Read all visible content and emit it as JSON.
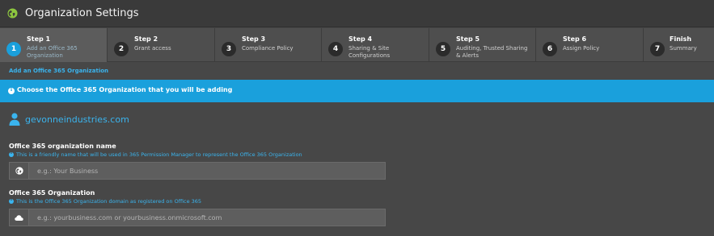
{
  "header": {
    "title": "Organization Settings",
    "logo_icon": "globe-icon"
  },
  "steps": [
    {
      "num": "1",
      "label": "Step 1",
      "desc": "Add an Office 365 Organization",
      "active": true
    },
    {
      "num": "2",
      "label": "Step 2",
      "desc": "Grant access",
      "active": false
    },
    {
      "num": "3",
      "label": "Step 3",
      "desc": "Compliance Policy",
      "active": false
    },
    {
      "num": "4",
      "label": "Step 4",
      "desc": "Sharing & Site Configurations",
      "active": false
    },
    {
      "num": "5",
      "label": "Step 5",
      "desc": "Auditing, Trusted Sharing & Alerts",
      "active": false
    },
    {
      "num": "6",
      "label": "Step 6",
      "desc": "Assign Policy",
      "active": false
    },
    {
      "num": "7",
      "label": "Finish",
      "desc": "Summary",
      "active": false
    }
  ],
  "breadcrumb": "Add an Office 365 Organization",
  "banner": {
    "text": "Choose the Office 365 Organization that you will be adding",
    "icon": "info-icon"
  },
  "organization": {
    "name": "gevonneindustries.com",
    "icon": "user-icon"
  },
  "form": {
    "name_field": {
      "label": "Office 365 organization name",
      "hint": "This is a friendly name that will be used in 365 Permission Manager to represent the Office 365 Organization",
      "placeholder": "e.g.: Your Business",
      "value": "",
      "icon": "globe-icon"
    },
    "domain_field": {
      "label": "Office 365 Organization",
      "hint": "This is the Office 365 Organization domain as registered on Office 365",
      "placeholder": "e.g.: yourbusiness.com or yourbusiness.onmicrosoft.com",
      "value": "",
      "icon": "cloud-icon"
    }
  },
  "colors": {
    "accent": "#1aa0dc",
    "link": "#3ab4ee",
    "logo": "#8dc63f",
    "background": "#474747"
  }
}
